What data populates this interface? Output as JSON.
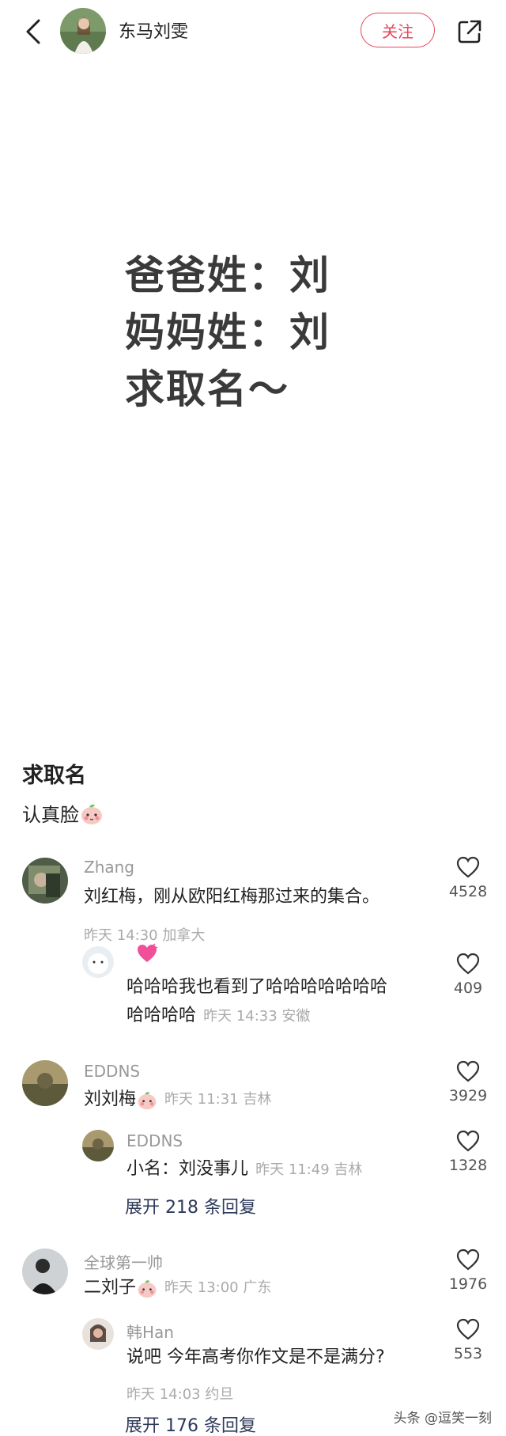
{
  "header": {
    "author": "东马刘雯",
    "follow_label": "关注"
  },
  "post_image_lines": [
    "爸爸姓：刘",
    "妈妈姓：刘",
    "求取名～"
  ],
  "post": {
    "title": "求取名",
    "body": "认真脸"
  },
  "comments": [
    {
      "name": "Zhang",
      "text": "刘红梅，刚从欧阳红梅那过来的集合。",
      "meta": "昨天 14:30 加拿大",
      "likes": "4528"
    },
    {
      "name": "",
      "text_line1": "哈哈哈我也看到了哈哈哈哈哈哈哈",
      "text_line2": "哈哈哈哈",
      "meta": "昨天 14:33 安徽",
      "likes": "409"
    },
    {
      "name": "EDDNS",
      "text": "刘刘梅",
      "meta": "昨天 11:31 吉林",
      "likes": "3929"
    },
    {
      "name": "EDDNS",
      "text": "小名：刘没事儿",
      "meta": "昨天 11:49 吉林",
      "likes": "1328"
    },
    {
      "name": "全球第一帅",
      "text": "二刘子",
      "meta": "昨天 13:00 广东",
      "likes": "1976"
    },
    {
      "name": "韩Han",
      "text": "说吧 今年高考你作文是不是满分?",
      "meta": "昨天 14:03 约旦",
      "likes": "553"
    }
  ],
  "expand_replies": [
    "展开 218 条回复",
    "展开 176 条回复"
  ],
  "watermark": "头条 @逗笑一刻",
  "colors": {
    "accent": "#e8455a",
    "expand_link": "#2d3a5a",
    "meta_gray": "#aaaaaa"
  }
}
